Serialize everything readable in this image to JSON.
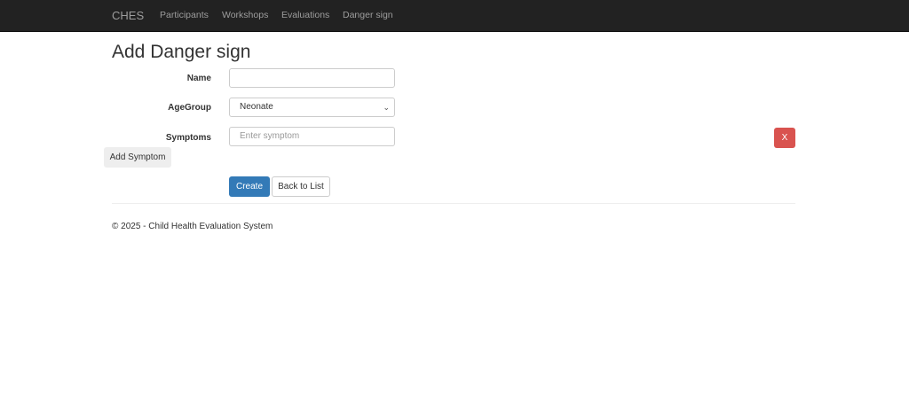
{
  "nav": {
    "brand": "CHES",
    "items": [
      "Participants",
      "Workshops",
      "Evaluations",
      "Danger sign"
    ]
  },
  "page": {
    "title": "Add Danger sign"
  },
  "form": {
    "name_label": "Name",
    "name_value": "",
    "agegroup_label": "AgeGroup",
    "agegroup_value": "Neonate",
    "symptoms_label": "Symptoms",
    "symptom_placeholder": "Enter symptom",
    "remove_label": "X",
    "add_symptom_label": "Add Symptom",
    "create_label": "Create",
    "back_label": "Back to List"
  },
  "footer": {
    "text": "© 2025 - Child Health Evaluation System"
  }
}
